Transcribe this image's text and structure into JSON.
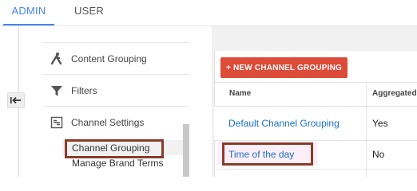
{
  "tabs": {
    "admin": "ADMIN",
    "user": "USER",
    "active": "admin"
  },
  "sidebar": {
    "items": [
      {
        "label": "Content Grouping",
        "icon": "person-walking-icon"
      },
      {
        "label": "Filters",
        "icon": "filter-funnel-icon"
      },
      {
        "label": "Channel Settings",
        "icon": "channel-settings-icon"
      }
    ],
    "subitems": [
      {
        "label": "Channel Grouping",
        "active": true
      },
      {
        "label": "Manage Brand Terms",
        "active": false
      }
    ],
    "back_icon": "arrow-left-bar-icon"
  },
  "main": {
    "new_button_label": "+ NEW CHANNEL GROUPING",
    "table": {
      "headers": [
        "Name",
        "Aggregated"
      ],
      "rows": [
        {
          "name": "Default Channel Grouping",
          "aggregated": "Yes"
        },
        {
          "name": "Time of the day",
          "aggregated": "No"
        }
      ]
    }
  },
  "colors": {
    "accent_blue": "#4285f4",
    "button_red": "#dd4b39",
    "link_blue": "#1a6fc1",
    "highlight_border": "#8b3a2a"
  }
}
